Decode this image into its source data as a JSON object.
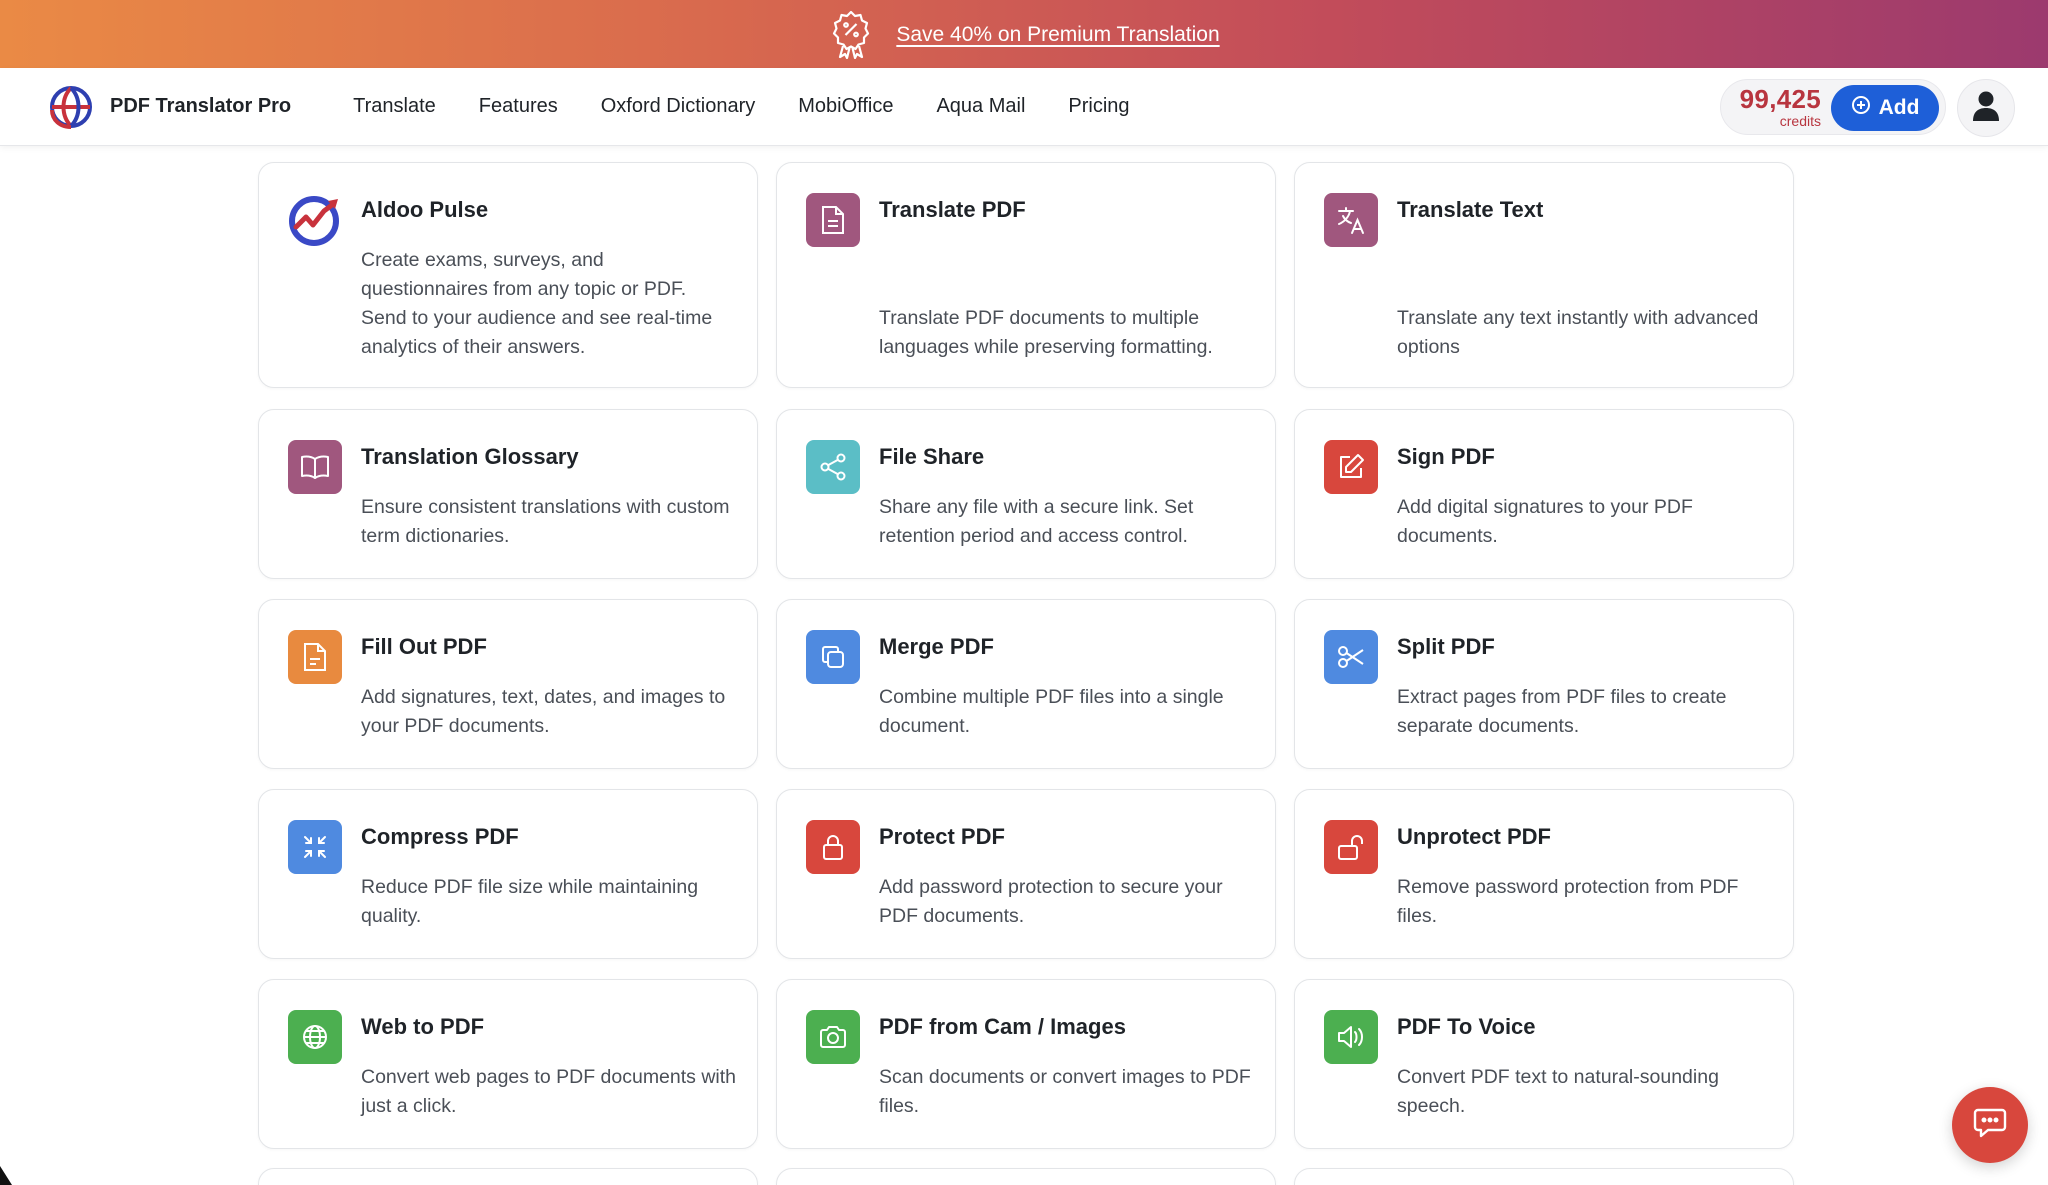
{
  "promo": {
    "text": "Save 40% on Premium Translation",
    "icon": "discount-badge-icon"
  },
  "nav": {
    "brand": "PDF Translator Pro",
    "items": [
      "Translate",
      "Features",
      "Oxford Dictionary",
      "MobiOffice",
      "Aqua Mail",
      "Pricing"
    ],
    "credits_value": "99,425",
    "credits_label": "credits",
    "add_label": "Add"
  },
  "colors": {
    "accent_blue": "#1e5fd8",
    "credits_red": "#b8353f",
    "banner_start": "#ea8a45",
    "banner_end": "#9c3a6e"
  },
  "cards": [
    {
      "title": "Aldoo Pulse",
      "desc": "Create exams, surveys, and questionnaires from any topic or PDF. Send to your audience and see real-time analytics of their answers.",
      "icon": "pulse-logo-icon",
      "color": "#ffffff"
    },
    {
      "title": "Translate PDF",
      "desc": "Translate PDF documents to multiple languages while preserving formatting.",
      "icon": "document-icon",
      "color": "#a0577e"
    },
    {
      "title": "Translate Text",
      "desc": "Translate any text instantly with advanced options",
      "icon": "translate-icon",
      "color": "#a0577e"
    },
    {
      "title": "Translation Glossary",
      "desc": "Ensure consistent translations with custom term dictionaries.",
      "icon": "book-icon",
      "color": "#a0577e"
    },
    {
      "title": "File Share",
      "desc": "Share any file with a secure link. Set retention period and access control.",
      "icon": "share-icon",
      "color": "#5bbec6"
    },
    {
      "title": "Sign PDF",
      "desc": "Add digital signatures to your PDF documents.",
      "icon": "pen-square-icon",
      "color": "#d8473d"
    },
    {
      "title": "Fill Out PDF",
      "desc": "Add signatures, text, dates, and images to your PDF documents.",
      "icon": "form-document-icon",
      "color": "#e88a3f"
    },
    {
      "title": "Merge PDF",
      "desc": "Combine multiple PDF files into a single document.",
      "icon": "merge-icon",
      "color": "#4f8ae0"
    },
    {
      "title": "Split PDF",
      "desc": "Extract pages from PDF files to create separate documents.",
      "icon": "scissors-icon",
      "color": "#4f8ae0"
    },
    {
      "title": "Compress PDF",
      "desc": "Reduce PDF file size while maintaining quality.",
      "icon": "compress-icon",
      "color": "#4f8ae0"
    },
    {
      "title": "Protect PDF",
      "desc": "Add password protection to secure your PDF documents.",
      "icon": "lock-icon",
      "color": "#d8473d"
    },
    {
      "title": "Unprotect PDF",
      "desc": "Remove password protection from PDF files.",
      "icon": "unlock-icon",
      "color": "#d8473d"
    },
    {
      "title": "Web to PDF",
      "desc": "Convert web pages to PDF documents with just a click.",
      "icon": "globe-icon",
      "color": "#4caf50"
    },
    {
      "title": "PDF from Cam / Images",
      "desc": "Scan documents or convert images to PDF files.",
      "icon": "camera-icon",
      "color": "#4caf50"
    },
    {
      "title": "PDF To Voice",
      "desc": "Convert PDF text to natural-sounding speech.",
      "icon": "speaker-icon",
      "color": "#4caf50"
    }
  ],
  "chat": {
    "icon": "chat-bubble-icon",
    "color": "#d8473d"
  }
}
